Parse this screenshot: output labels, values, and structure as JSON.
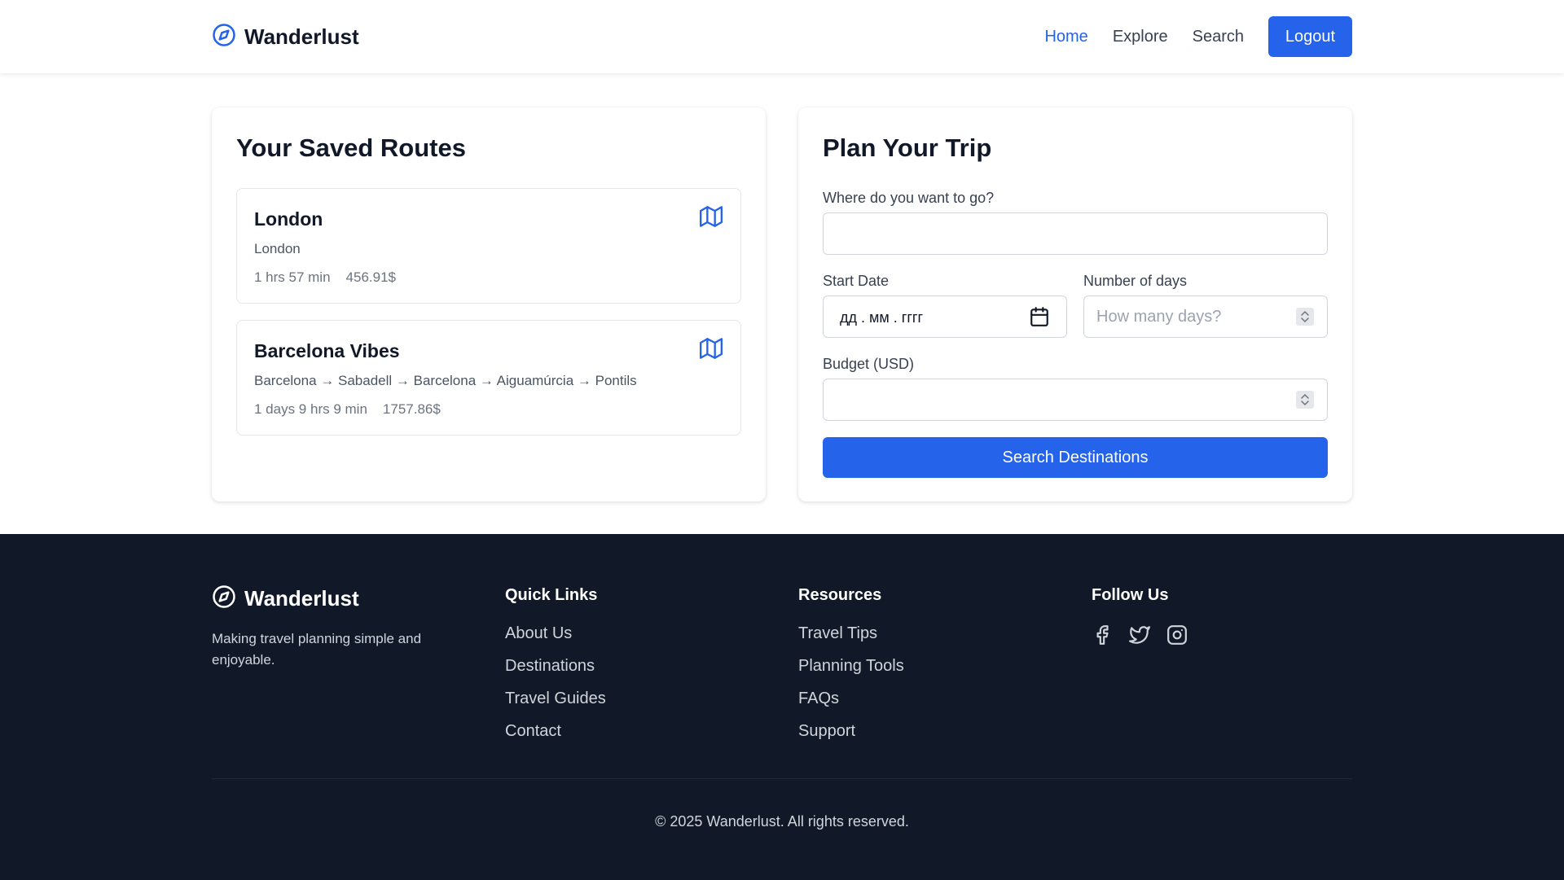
{
  "header": {
    "brand": "Wanderlust",
    "brand_icon": "compass-icon",
    "nav": [
      {
        "label": "Home",
        "active": true
      },
      {
        "label": "Explore",
        "active": false
      },
      {
        "label": "Search",
        "active": false
      }
    ],
    "logout_label": "Logout"
  },
  "saved_routes": {
    "title": "Your Saved Routes",
    "routes": [
      {
        "name": "London",
        "path": "London",
        "duration": "1 hrs 57 min",
        "price": "456.91$",
        "icon": "map-icon"
      },
      {
        "name": "Barcelona Vibes",
        "path": "Barcelona → Sabadell → Barcelona → Aiguamúrcia → Pontils",
        "duration": "1 days 9 hrs 9 min",
        "price": "1757.86$",
        "icon": "map-icon"
      }
    ]
  },
  "plan_trip": {
    "title": "Plan Your Trip",
    "destination_label": "Where do you want to go?",
    "destination_value": "",
    "start_date_label": "Start Date",
    "start_date_placeholder": "дд . мм . гггг",
    "days_label": "Number of days",
    "days_placeholder": "How many days?",
    "budget_label": "Budget (USD)",
    "budget_value": "",
    "search_label": "Search Destinations"
  },
  "footer": {
    "brand": "Wanderlust",
    "tagline": "Making travel planning simple and enjoyable.",
    "quick_links": {
      "title": "Quick Links",
      "items": [
        "About Us",
        "Destinations",
        "Travel Guides",
        "Contact"
      ]
    },
    "resources": {
      "title": "Resources",
      "items": [
        "Travel Tips",
        "Planning Tools",
        "FAQs",
        "Support"
      ]
    },
    "follow": {
      "title": "Follow Us",
      "icons": [
        "facebook-icon",
        "twitter-icon",
        "instagram-icon"
      ]
    },
    "copyright": "© 2025 Wanderlust. All rights reserved."
  },
  "colors": {
    "accent": "#2563eb",
    "footer_bg": "#111827"
  }
}
